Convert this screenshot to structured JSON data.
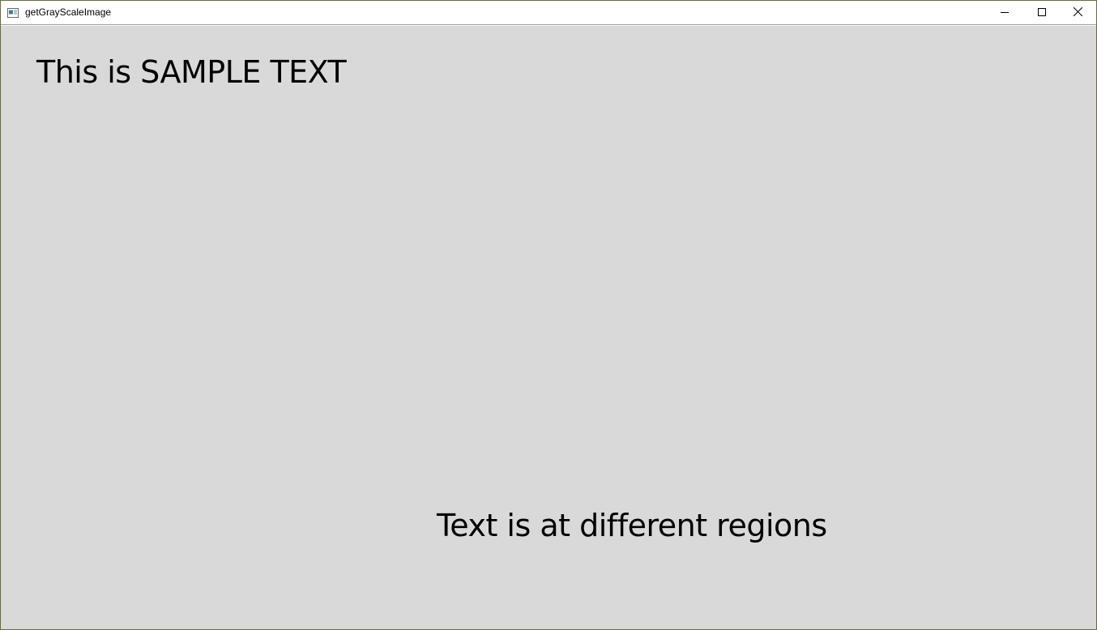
{
  "window": {
    "title": "getGrayScaleImage",
    "app_icon": "window-app-icon",
    "controls": {
      "minimize_icon": "minimize-icon",
      "maximize_icon": "maximize-icon",
      "close_icon": "close-icon"
    }
  },
  "canvas": {
    "background_color": "#d9d9d9",
    "text_top": "This is SAMPLE TEXT",
    "text_bottom": "Text is at different regions"
  }
}
